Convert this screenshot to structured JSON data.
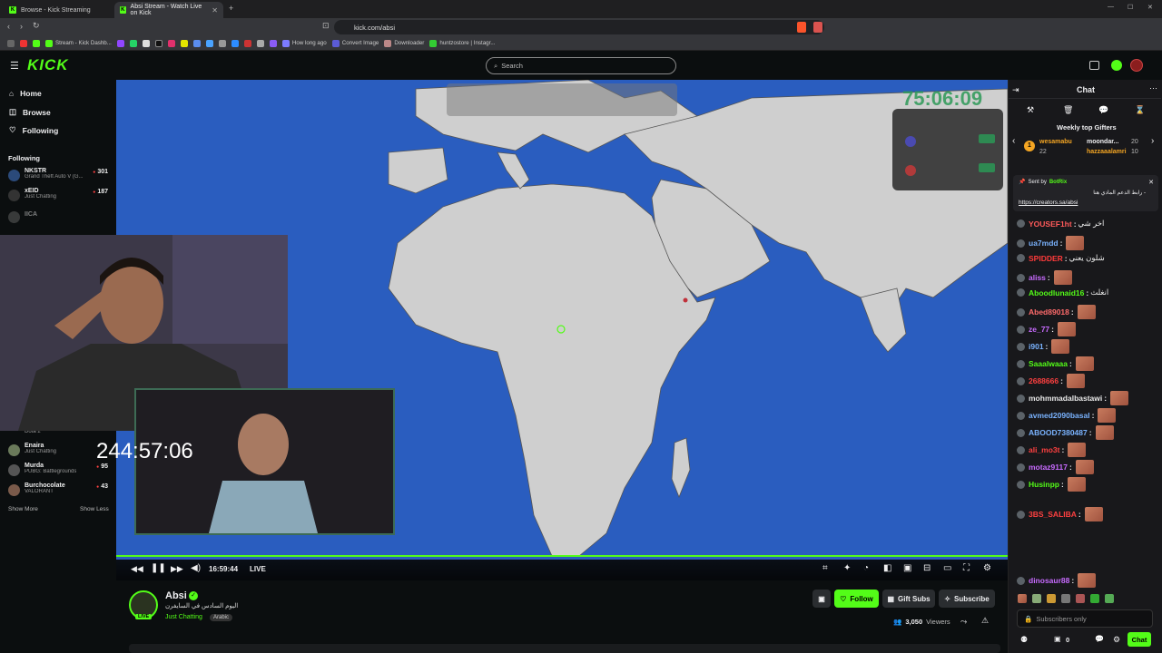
{
  "browser": {
    "tabs": [
      {
        "title": "Browse - Kick Streaming"
      },
      {
        "title": "Absi Stream - Watch Live on Kick"
      }
    ],
    "url": "kick.com/absi",
    "bookmarks": [
      "Stream - Kick Dashb...",
      "How long ago",
      "Convert Image",
      "Downloader",
      "huntzostore | Instagr..."
    ]
  },
  "header": {
    "logo": "KICK",
    "search_placeholder": "Search"
  },
  "sidebar": {
    "nav": [
      {
        "label": "Home",
        "icon": "home-icon"
      },
      {
        "label": "Browse",
        "icon": "compass-icon"
      },
      {
        "label": "Following",
        "icon": "heart-icon"
      }
    ],
    "following_title": "Following",
    "following": [
      {
        "name": "NKSTR",
        "category": "Grand Theft Auto V (G...",
        "viewers": "301"
      },
      {
        "name": "xEID",
        "category": "Just Chatting",
        "viewers": "187"
      },
      {
        "name": "IICA",
        "category": "",
        "viewers": ""
      },
      {
        "name": "",
        "category": "Dota 2",
        "viewers": ""
      },
      {
        "name": "Enaira",
        "category": "Just Chatting",
        "viewers": ""
      },
      {
        "name": "Murda",
        "category": "PUBG: Battlegrounds",
        "viewers": "95"
      },
      {
        "name": "Burchocolate",
        "category": "VALORANT",
        "viewers": "43"
      }
    ],
    "show_more": "Show More",
    "show_less": "Show Less"
  },
  "player": {
    "timer_overlay": "244:57:06",
    "corner_timer": "75:06:09",
    "elapsed": "16:59:44",
    "live_label": "LIVE",
    "progress": 1.0
  },
  "stream": {
    "streamer": "Absi",
    "title": "اليوم السادس في السايفرن",
    "category": "Just Chatting",
    "language": "Arabic",
    "live_badge": "LIVE",
    "viewers": "3,050",
    "viewers_label": "Viewers"
  },
  "actions": {
    "follow": "Follow",
    "gift": "Gift Subs",
    "subscribe": "Subscribe"
  },
  "chat": {
    "title": "Chat",
    "gifters_title": "Weekly top Gifters",
    "gifters": [
      {
        "name": "wesamabu",
        "count": "22"
      },
      {
        "name": "moondar...",
        "count": "20"
      },
      {
        "name": "hazzaaalamri",
        "count": "10"
      }
    ],
    "pinned": {
      "sent_by": "Sent by",
      "bot": "BotRix",
      "text": "- رابط الدعم المادي هنا",
      "link": "https://creators.sa/absi"
    },
    "messages": [
      {
        "user": "YOUSEF1ht",
        "color": "#ff5a5a",
        "msg": "اخر شي"
      },
      {
        "user": "ua7mdd",
        "color": "#7ab3ff",
        "msg": ""
      },
      {
        "user": "SPIDDER",
        "color": "#ff3b3b",
        "msg": "شلون يعني"
      },
      {
        "user": "aliss",
        "color": "#c86bff",
        "msg": ""
      },
      {
        "user": "Aboodlunaid16",
        "color": "#53fc18",
        "msg": "انغلث"
      },
      {
        "user": "Abed89018",
        "color": "#ff6b6b",
        "msg": ""
      },
      {
        "user": "ze_77",
        "color": "#c86bff",
        "msg": ""
      },
      {
        "user": "i901",
        "color": "#7ab3ff",
        "msg": ""
      },
      {
        "user": "Saaalwaaa",
        "color": "#53fc18",
        "msg": ""
      },
      {
        "user": "2688666",
        "color": "#ff4040",
        "msg": ""
      },
      {
        "user": "mohmmadalbastawi",
        "color": "#e8e8e8",
        "msg": ""
      },
      {
        "user": "avmed2090basal",
        "color": "#7ab3ff",
        "msg": ""
      },
      {
        "user": "ABOOD7380487",
        "color": "#7ab3ff",
        "msg": ""
      },
      {
        "user": "ali_mo3t",
        "color": "#ff4040",
        "msg": ""
      },
      {
        "user": "motaz9117",
        "color": "#c86bff",
        "msg": ""
      },
      {
        "user": "Husinpp",
        "color": "#53fc18",
        "msg": ""
      },
      {
        "user": "3BS_SALIBA",
        "color": "#ff4040",
        "msg": ""
      },
      {
        "user": "dinosaur88",
        "color": "#c86bff",
        "msg": ""
      }
    ],
    "input_placeholder": "Subscribers only",
    "send": "Chat",
    "points": "0"
  },
  "colors": {
    "brand": "#53fc18",
    "bg": "#0b0e0f",
    "chat_bg": "#18181b",
    "ocean": "#2a5dbf",
    "land": "#cfcfcf"
  }
}
